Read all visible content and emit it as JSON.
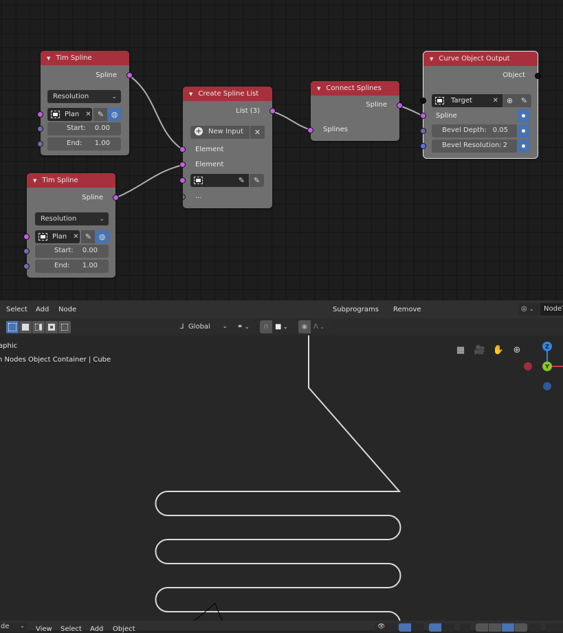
{
  "node_editor": {
    "nodes": {
      "tim_spline_1": {
        "title": "Tim Spline",
        "output": "Spline",
        "mode": "Resolution",
        "object": "Plan",
        "start_label": "Start:",
        "start_value": "0.00",
        "end_label": "End:",
        "end_value": "1.00"
      },
      "tim_spline_2": {
        "title": "Tim Spline",
        "output": "Spline",
        "mode": "Resolution",
        "object": "Plan",
        "start_label": "Start:",
        "start_value": "0.00",
        "end_label": "End:",
        "end_value": "1.00"
      },
      "create_spline_list": {
        "title": "Create Spline List",
        "output": "List (3)",
        "new_input_label": "New Input",
        "inputs": [
          "Element",
          "Element"
        ],
        "more": "..."
      },
      "connect_splines": {
        "title": "Connect Splines",
        "output": "Spline",
        "input": "Splines"
      },
      "curve_object_output": {
        "title": "Curve Object Output",
        "output": "Object",
        "target": "Target",
        "spline_label": "Spline",
        "bevel_depth_label": "Bevel Depth:",
        "bevel_depth_value": "0.05",
        "bevel_resolution_label": "Bevel Resolution:",
        "bevel_resolution_value": "2"
      }
    }
  },
  "node_header": {
    "menus": [
      "Select",
      "Add",
      "Node"
    ],
    "right_menus": [
      "Subprograms",
      "Remove"
    ],
    "tree_name": "NodeT"
  },
  "viewport_toolbar": {
    "transform_orientation": "Global"
  },
  "viewport": {
    "view_name": "aphic",
    "collection_info": "n Nodes Object Container | Cube",
    "gizmo": {
      "z": "Z",
      "y": "Y"
    }
  },
  "viewport_header": {
    "mode": "de",
    "menus": [
      "View",
      "Select",
      "Add",
      "Object"
    ]
  },
  "colors": {
    "node_header": "#a8303c",
    "node_body": "#6f6f6f",
    "spline_socket": "#c15ee0",
    "accent_blue": "#4772b3"
  }
}
